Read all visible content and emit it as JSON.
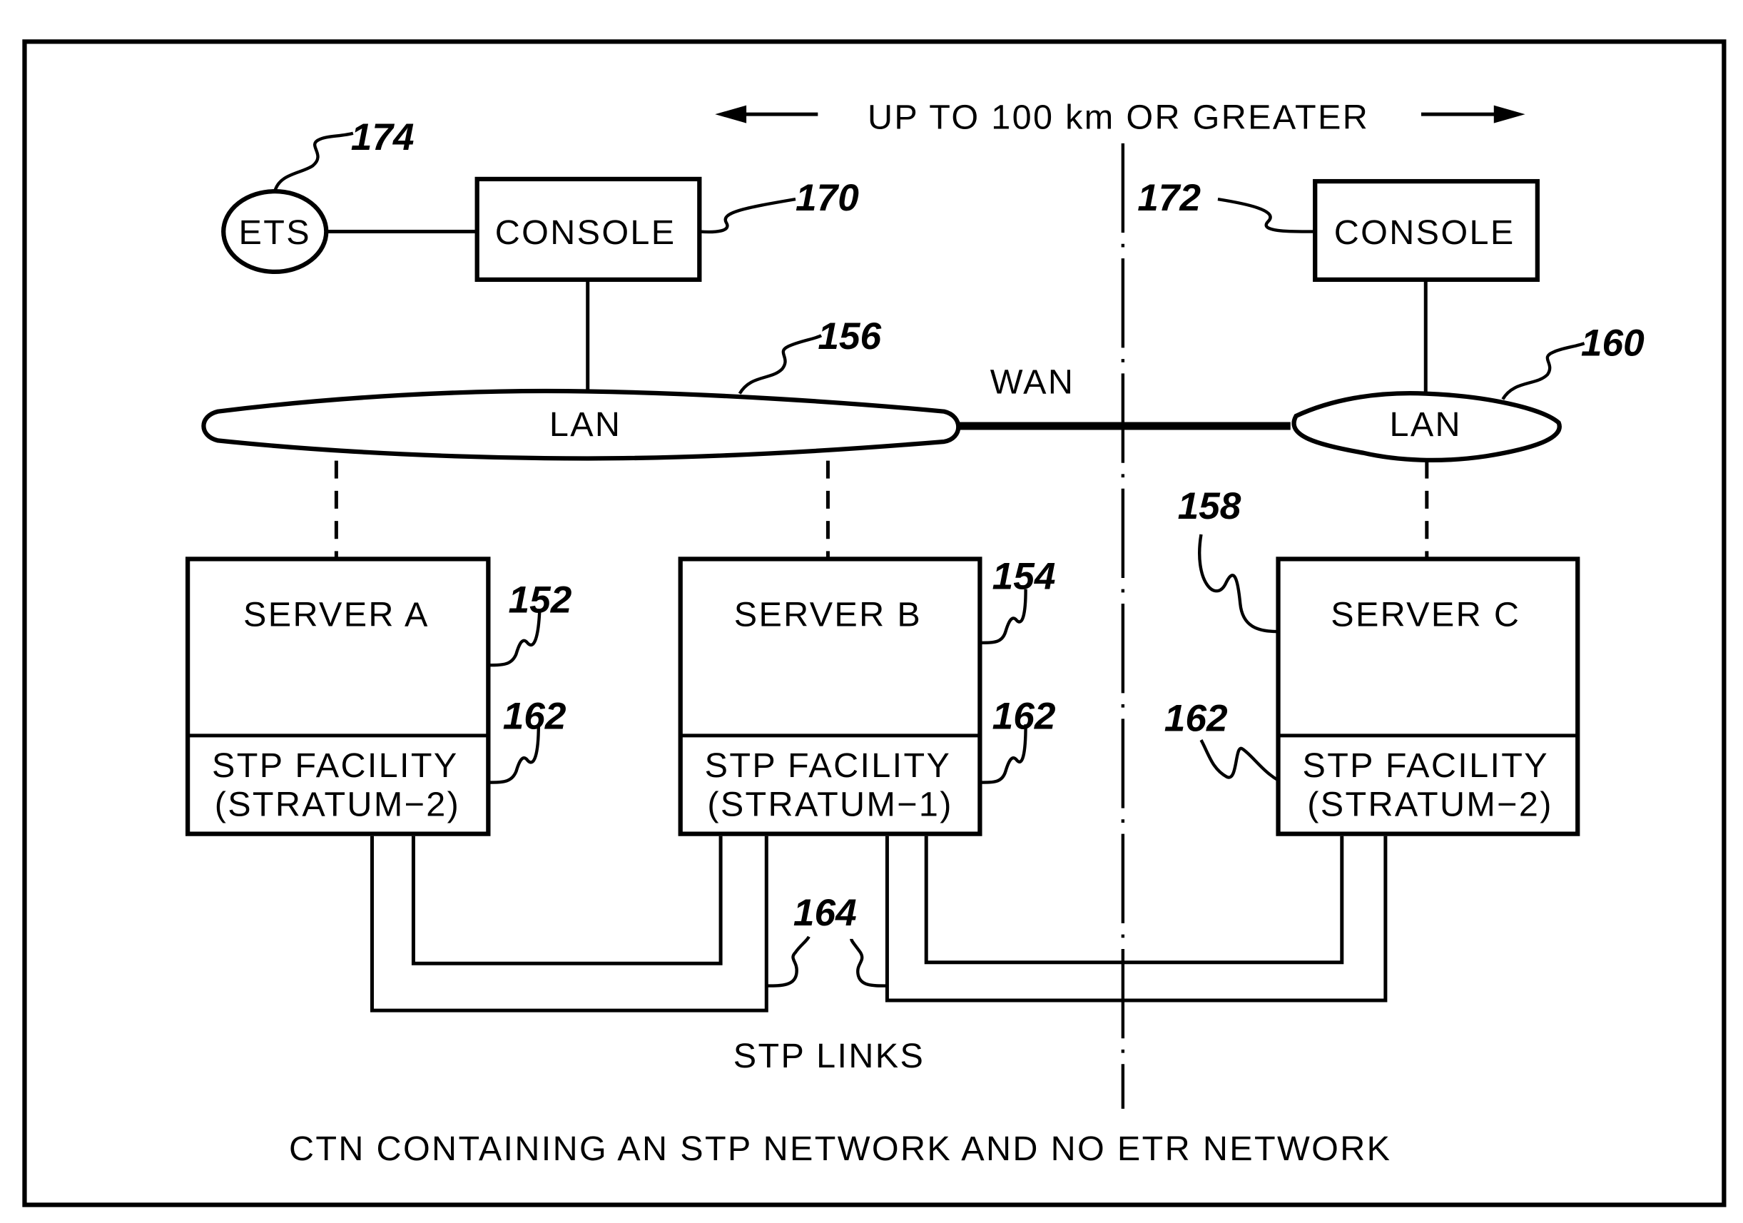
{
  "figure": {
    "distance_label": "UP TO 100 km OR GREATER",
    "caption": "CTN CONTAINING AN STP NETWORK AND NO ETR NETWORK",
    "wan_label": "WAN",
    "stp_links_label": "STP LINKS"
  },
  "nodes": {
    "ets": {
      "label": "ETS",
      "ref": "174"
    },
    "console_a": {
      "label": "CONSOLE",
      "ref": "170"
    },
    "console_c": {
      "label": "CONSOLE",
      "ref": "172"
    },
    "lan_a": {
      "label": "LAN",
      "ref": "156"
    },
    "lan_c": {
      "label": "LAN",
      "ref": "160"
    },
    "server_a": {
      "label": "SERVER A",
      "ref": "152",
      "stp_line1": "STP FACILITY",
      "stp_line2": "(STRATUM−2)",
      "stp_ref": "162"
    },
    "server_b": {
      "label": "SERVER B",
      "ref": "154",
      "stp_line1": "STP FACILITY",
      "stp_line2": "(STRATUM−1)",
      "stp_ref": "162"
    },
    "server_c": {
      "label": "SERVER C",
      "ref": "158",
      "stp_line1": "STP FACILITY",
      "stp_line2": "(STRATUM−2)",
      "stp_ref": "162"
    },
    "stp_links": {
      "ref": "164"
    }
  }
}
